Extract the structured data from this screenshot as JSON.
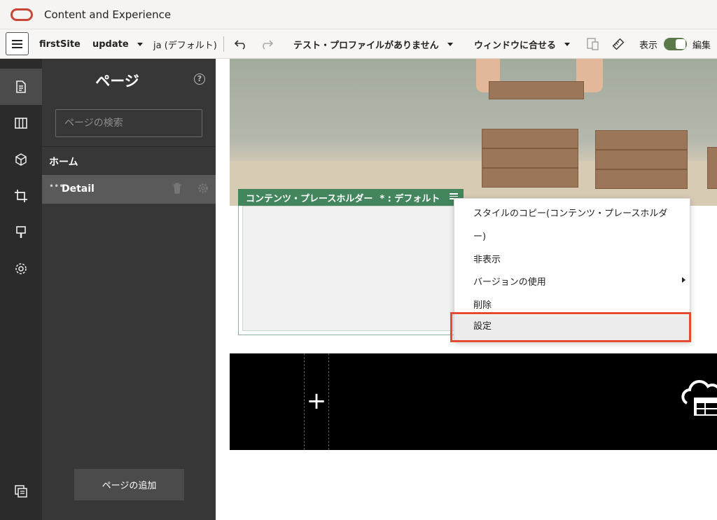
{
  "app": {
    "title": "Content and Experience"
  },
  "toolbar": {
    "site_name": "firstSite",
    "update_name": "update",
    "language": "ja (デフォルト)",
    "test_profile": "テスト・プロファイルがありません",
    "fit_window": "ウィンドウに合せる",
    "view_label": "表示",
    "edit_label": "編集",
    "edit_toggle_on": true
  },
  "rail": {
    "items": [
      "pages-icon",
      "layout-icon",
      "components-icon",
      "crop-icon",
      "theme-icon",
      "settings-icon"
    ],
    "bottom": "site-tree-icon",
    "active_index": 0
  },
  "panel": {
    "title": "ページ",
    "search_placeholder": "ページの検索",
    "pages": [
      {
        "label": "ホーム",
        "selected": false
      },
      {
        "label": "Detail",
        "selected": true
      }
    ],
    "add_button": "ページの追加"
  },
  "canvas": {
    "placeholder": {
      "title": "コンテンツ・プレースホルダー",
      "default_label": "* : デフォルト"
    }
  },
  "context_menu": {
    "items": [
      {
        "label": "スタイルのコピー(コンテンツ・プレースホルダ"
      },
      {
        "label": "ー)"
      },
      {
        "label": "非表示"
      },
      {
        "label": "バージョンの使用",
        "has_submenu": true
      },
      {
        "label": "削除"
      },
      {
        "label": "設定",
        "highlighted": true
      }
    ]
  },
  "colors": {
    "accent_green": "#43855d",
    "toggle_green": "#5c7a49",
    "highlight_red": "#e54a33",
    "oracle_red": "#c74634"
  }
}
